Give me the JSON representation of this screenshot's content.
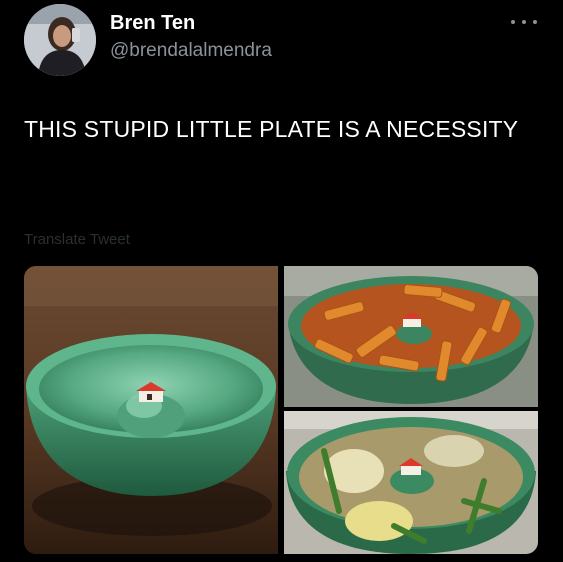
{
  "tweet": {
    "author_name": "Bren Ten",
    "author_handle": "@brendalalmendra",
    "text": "THIS STUPID LITTLE PLATE IS A NECESSITY",
    "translate_label": "Translate Tweet"
  },
  "icons": {
    "more": "more-options-icon"
  },
  "colors": {
    "background": "#000000",
    "primary_text": "#ffffff",
    "secondary_text": "#8b9299",
    "bowl_green": "#3f8f6a"
  }
}
